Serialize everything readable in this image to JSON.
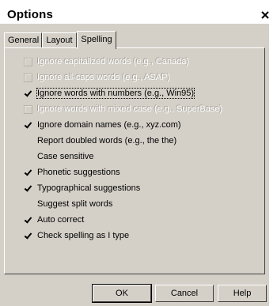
{
  "window": {
    "title": "Options",
    "close_glyph": "×"
  },
  "tabs": [
    {
      "label": "General",
      "active": false
    },
    {
      "label": "Layout",
      "active": false
    },
    {
      "label": "Spelling",
      "active": true
    }
  ],
  "options": [
    {
      "label": "Ignore capitalized words (e.g., Canada)",
      "checked": false,
      "enabled": false
    },
    {
      "label": "Ignore all-caps words (e.g., ASAP)",
      "checked": false,
      "enabled": false
    },
    {
      "label": "Ignore words with numbers (e.g., Win95)",
      "checked": true,
      "enabled": true,
      "focused": true
    },
    {
      "label": "Ignore words with mixed case (e.g., SuperBase)",
      "checked": false,
      "enabled": false
    },
    {
      "label": "Ignore domain names (e.g., xyz.com)",
      "checked": true,
      "enabled": true
    },
    {
      "label": "Report doubled words (e.g., the the)",
      "checked": false,
      "enabled": true
    },
    {
      "label": "Case sensitive",
      "checked": false,
      "enabled": true
    },
    {
      "label": "Phonetic suggestions",
      "checked": true,
      "enabled": true
    },
    {
      "label": "Typographical suggestions",
      "checked": true,
      "enabled": true
    },
    {
      "label": "Suggest split words",
      "checked": false,
      "enabled": true
    },
    {
      "label": "Auto correct",
      "checked": true,
      "enabled": true
    },
    {
      "label": "Check spelling as I type",
      "checked": true,
      "enabled": true
    }
  ],
  "buttons": {
    "ok": "OK",
    "cancel": "Cancel",
    "help": "Help"
  }
}
